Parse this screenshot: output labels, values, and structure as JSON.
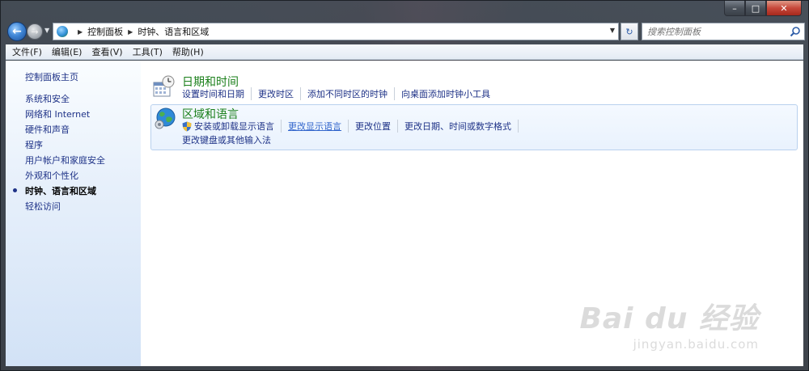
{
  "window": {
    "caption_min": "–",
    "caption_max": "□",
    "caption_close": "✕"
  },
  "address_bar": {
    "breadcrumbs": [
      "控制面板",
      "时钟、语言和区域"
    ],
    "search_placeholder": "搜索控制面板"
  },
  "menu": {
    "items": [
      "文件(F)",
      "编辑(E)",
      "查看(V)",
      "工具(T)",
      "帮助(H)"
    ]
  },
  "sidebar": {
    "home": "控制面板主页",
    "items": [
      "系统和安全",
      "网络和 Internet",
      "硬件和声音",
      "程序",
      "用户帐户和家庭安全",
      "外观和个性化",
      "时钟、语言和区域",
      "轻松访问"
    ],
    "current_index": 6
  },
  "main": {
    "categories": [
      {
        "title": "日期和时间",
        "icon": "calendar-clock-icon",
        "links": [
          "设置时间和日期",
          "更改时区",
          "添加不同时区的时钟",
          "向桌面添加时钟小工具"
        ]
      },
      {
        "title": "区域和语言",
        "icon": "globe-icon",
        "links": [
          "安装或卸载显示语言",
          "更改显示语言",
          "更改位置",
          "更改日期、时间或数字格式"
        ],
        "links2": [
          "更改键盘或其他输入法"
        ]
      }
    ]
  },
  "watermark": {
    "logo": "Bai du 经验",
    "url": "jingyan.baidu.com"
  },
  "colors": {
    "link": "#1e3287",
    "category_title": "#1a7f1a",
    "sidebar_bg": "#e7f0fb"
  }
}
